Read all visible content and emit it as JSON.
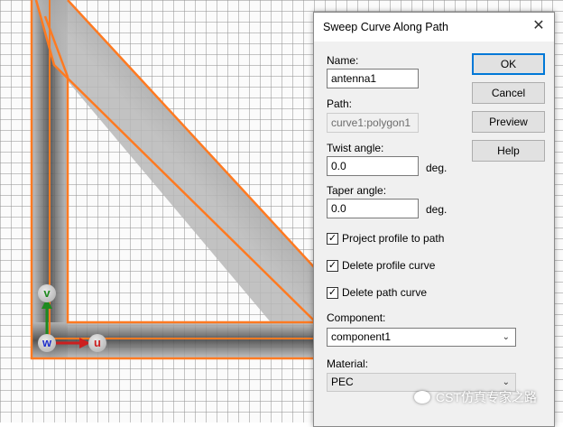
{
  "dialog": {
    "title": "Sweep Curve Along Path",
    "close_glyph": "✕",
    "name_label": "Name:",
    "name_value": "antenna1",
    "path_label": "Path:",
    "path_value": "curve1:polygon1",
    "twist_label": "Twist angle:",
    "twist_value": "0.0",
    "twist_unit": "deg.",
    "taper_label": "Taper angle:",
    "taper_value": "0.0",
    "taper_unit": "deg.",
    "checkboxes": [
      {
        "label": "Project profile to path",
        "checked": true
      },
      {
        "label": "Delete profile curve",
        "checked": true
      },
      {
        "label": "Delete path curve",
        "checked": true
      }
    ],
    "component_label": "Component:",
    "component_value": "component1",
    "material_label": "Material:",
    "material_value": "PEC",
    "buttons": {
      "ok": "OK",
      "cancel": "Cancel",
      "preview": "Preview",
      "help": "Help"
    }
  },
  "axes": {
    "v": "v",
    "w": "w",
    "u": "u"
  },
  "watermark": "CST仿真专家之路",
  "colors": {
    "outline": "#ff7a21",
    "axis_v": "#1f8a1f",
    "axis_u": "#cc1f1f",
    "axis_w": "#1f2fcc"
  }
}
